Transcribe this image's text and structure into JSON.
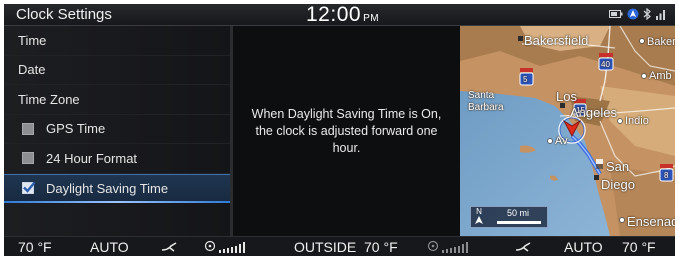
{
  "header": {
    "title": "Clock Settings",
    "time": "12:00",
    "ampm": "PM"
  },
  "menu": {
    "items": [
      {
        "label": "Time"
      },
      {
        "label": "Date"
      },
      {
        "label": "Time Zone"
      },
      {
        "label": "GPS Time",
        "checked": false
      },
      {
        "label": "24 Hour Format",
        "checked": false
      },
      {
        "label": "Daylight Saving Time",
        "checked": true,
        "selected": true
      }
    ]
  },
  "info": {
    "text": "When Daylight Saving Time is On, the clock is adjusted forward one hour."
  },
  "map": {
    "labels": {
      "bakersfield": "Bakersfield",
      "baker": "Baker",
      "amb": "Amb",
      "santa_barbara_1": "Santa",
      "santa_barbara_2": "Barbara",
      "los": "Los",
      "angeles": "Angeles",
      "indio": "Indio",
      "av": "Av",
      "san": "San",
      "diego": "Diego",
      "ensenada": "Ensenad"
    },
    "shields": {
      "i5": "5",
      "i40": "40",
      "i15": "15",
      "i8": "8"
    },
    "scale": "50 mi",
    "north": "N"
  },
  "climate": {
    "left_temp": "70 °F",
    "left_mode": "AUTO",
    "outside": "OUTSIDE  70 °F",
    "right_mode": "AUTO",
    "right_temp": "70 °F"
  },
  "colors": {
    "accent": "#3f6fa8",
    "selected_bg": "#1f3550",
    "route": "#3d6fe0"
  }
}
